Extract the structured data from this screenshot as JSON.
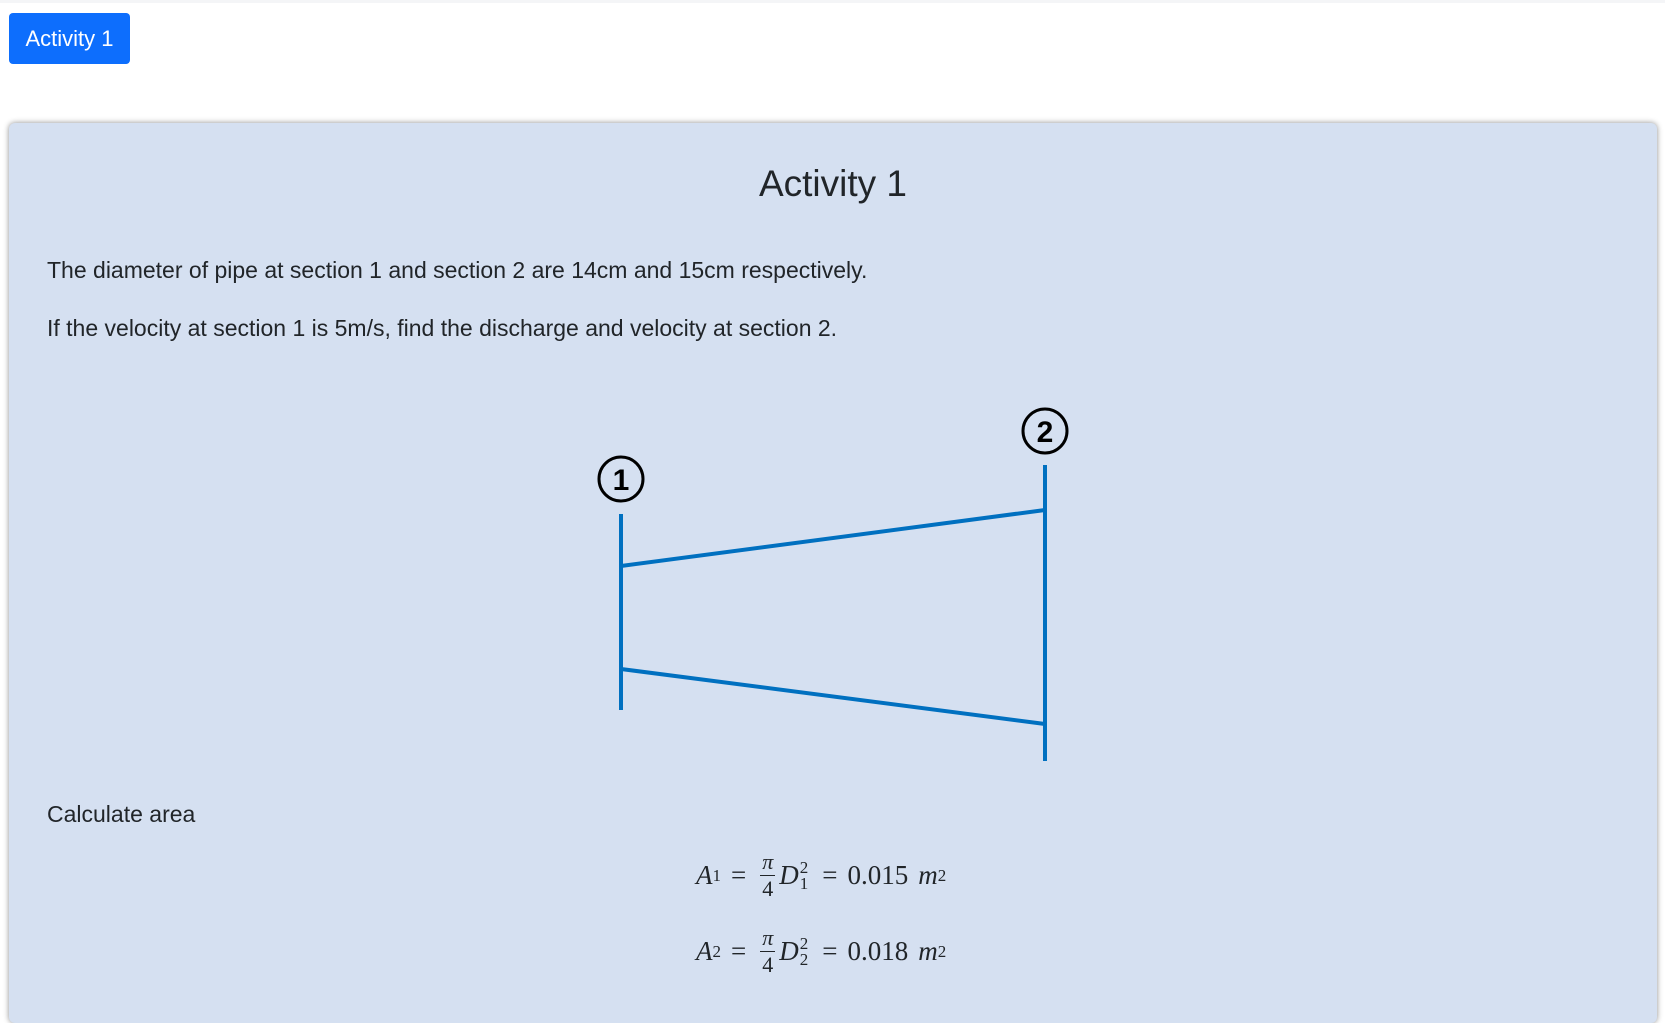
{
  "tab": {
    "label": "Activity 1"
  },
  "card": {
    "title": "Activity 1",
    "paragraph1": "The diameter of pipe at section 1 and section 2 are 14cm and 15cm respectively.",
    "paragraph2": "If the velocity at section 1 is 5m/s, find the discharge and velocity at section 2.",
    "paragraph3": "Calculate area"
  },
  "diagram": {
    "section1_label": "1",
    "section2_label": "2",
    "line_color": "#0070c0"
  },
  "equations": [
    {
      "lhs_var": "A",
      "lhs_sub": "1",
      "frac_num": "π",
      "frac_den": "4",
      "var": "D",
      "var_sub": "1",
      "var_sup": "2",
      "result": "0.015",
      "unit": "m",
      "unit_sup": "2"
    },
    {
      "lhs_var": "A",
      "lhs_sub": "2",
      "frac_num": "π",
      "frac_den": "4",
      "var": "D",
      "var_sub": "2",
      "var_sup": "2",
      "result": "0.018",
      "unit": "m",
      "unit_sup": "2"
    }
  ],
  "colors": {
    "primary_button": "#0d6efd",
    "card_background": "#d5e0f1"
  }
}
